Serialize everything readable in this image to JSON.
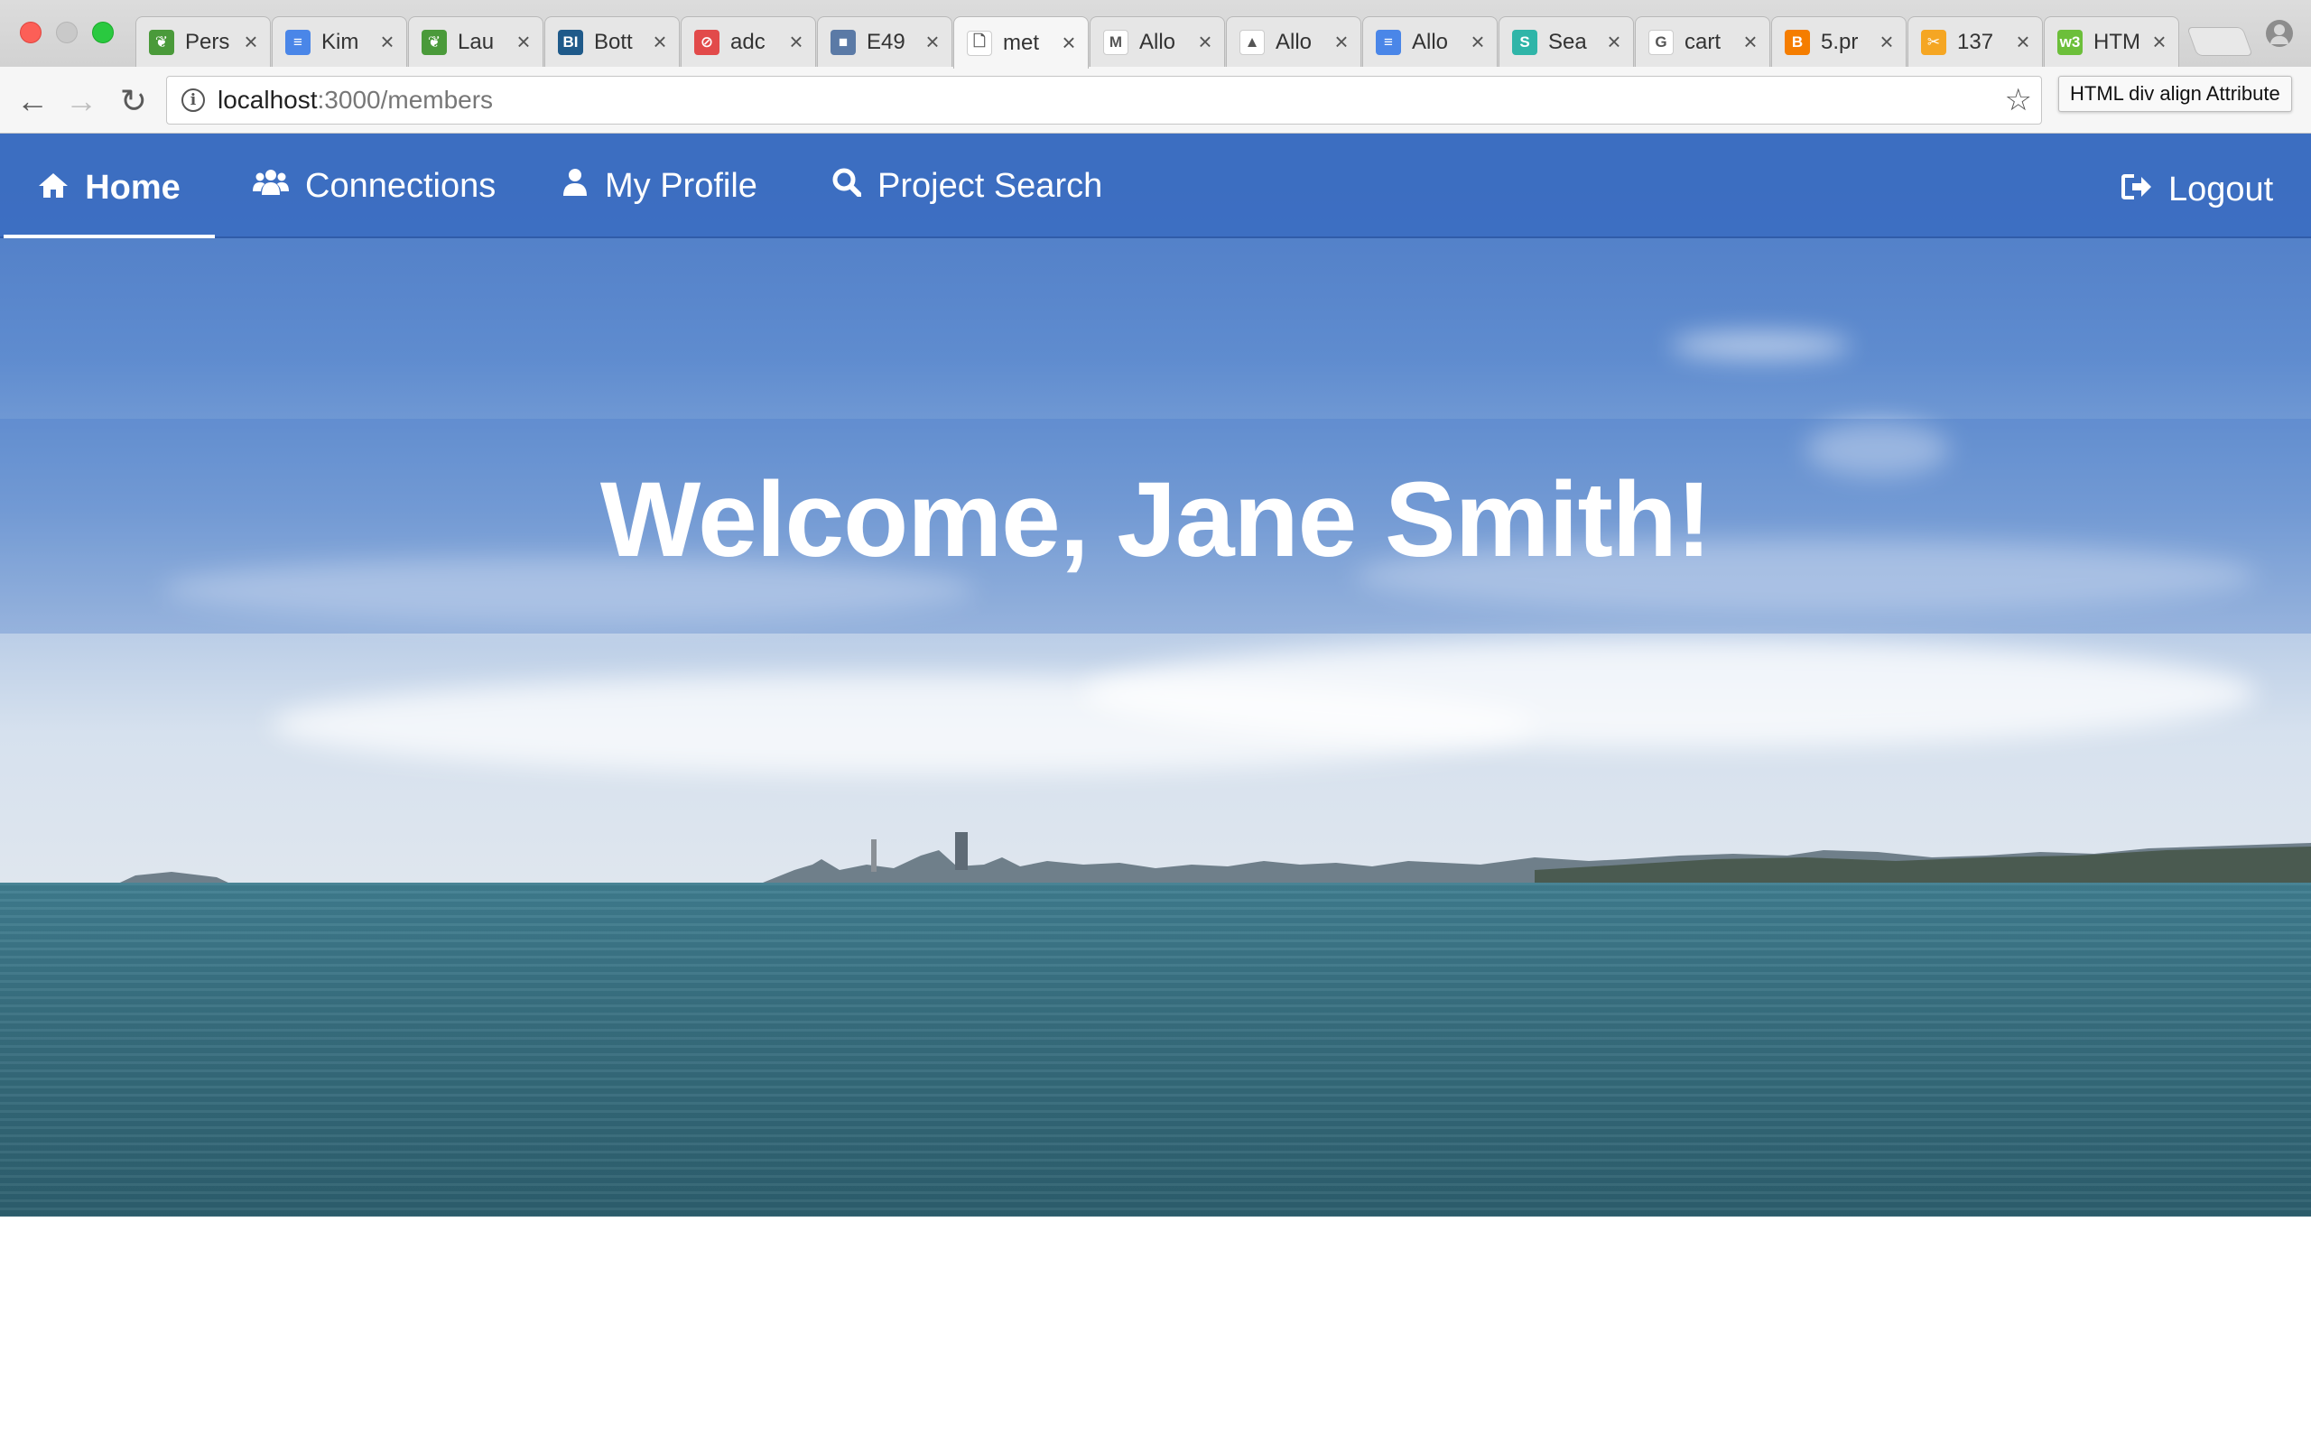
{
  "browser": {
    "tabs": [
      {
        "title": "Pers",
        "favicon": "leaf-icon",
        "color": "#4a9a3a",
        "glyph": "❦"
      },
      {
        "title": "Kim",
        "favicon": "google-docs-icon",
        "color": "#4a86e8",
        "glyph": "≡"
      },
      {
        "title": "Lau",
        "favicon": "leaf-icon",
        "color": "#4a9a3a",
        "glyph": "❦"
      },
      {
        "title": "Bott",
        "favicon": "bi-icon",
        "color": "#1f5a8a",
        "glyph": "BI"
      },
      {
        "title": "adc",
        "favicon": "no-entry-icon",
        "color": "#e24a4a",
        "glyph": "⊘"
      },
      {
        "title": "E49",
        "favicon": "square-app-icon",
        "color": "#5b7aa6",
        "glyph": "■"
      },
      {
        "title": "met",
        "favicon": "page-icon",
        "color": "#ffffff",
        "glyph": "🗋"
      },
      {
        "title": "Allo",
        "favicon": "gmail-icon",
        "color": "#ffffff",
        "glyph": "M"
      },
      {
        "title": "Allo",
        "favicon": "google-drive-icon",
        "color": "#ffffff",
        "glyph": "▲"
      },
      {
        "title": "Allo",
        "favicon": "google-docs-icon",
        "color": "#4a86e8",
        "glyph": "≡"
      },
      {
        "title": "Sea",
        "favicon": "s-app-icon",
        "color": "#2fb5a8",
        "glyph": "S"
      },
      {
        "title": "cart",
        "favicon": "google-icon",
        "color": "#ffffff",
        "glyph": "G"
      },
      {
        "title": "5.pr",
        "favicon": "blogger-icon",
        "color": "#f57d00",
        "glyph": "B"
      },
      {
        "title": "137",
        "favicon": "scissors-icon",
        "color": "#f5a623",
        "glyph": "✂"
      },
      {
        "title": "HTM",
        "favicon": "w3-icon",
        "color": "#6cbf3a",
        "glyph": "w3"
      }
    ],
    "active_tab": 6,
    "url_host": "localhost",
    "url_rest": ":3000/members",
    "tooltip": "HTML div align Attribute"
  },
  "navbar": {
    "home": "Home",
    "connections": "Connections",
    "my_profile": "My Profile",
    "project_search": "Project Search",
    "logout": "Logout",
    "bar_color": "#3a6cc0"
  },
  "hero": {
    "heading": "Welcome, Jane Smith!"
  }
}
